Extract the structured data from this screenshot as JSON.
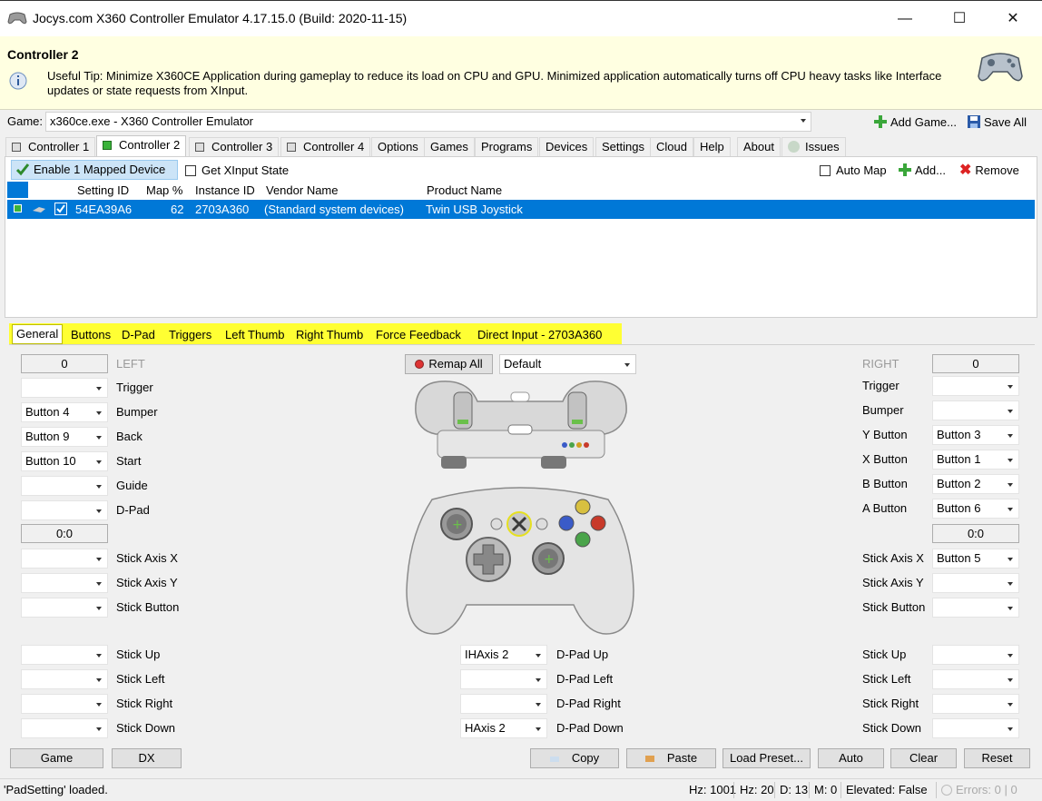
{
  "window": {
    "title": "Jocys.com X360 Controller Emulator 4.17.15.0 (Build: 2020-11-15)",
    "minimize": "—",
    "maximize": "☐",
    "close": "✕"
  },
  "tip": {
    "heading": "Controller 2",
    "text": "Useful Tip: Minimize X360CE Application during gameplay to reduce its load on CPU and GPU. Minimized application automatically turns off CPU heavy tasks like Interface updates or state requests from XInput."
  },
  "game": {
    "label": "Game:",
    "value": "x360ce.exe - X360 Controller Emulator",
    "add_game": "Add Game...",
    "save_all": "Save All"
  },
  "tabs": [
    "Controller 1",
    "Controller 2",
    "Controller 3",
    "Controller 4",
    "Options",
    "Games",
    "Programs",
    "Devices",
    "Settings",
    "Cloud",
    "Help",
    "About",
    "Issues"
  ],
  "device_toolbar": {
    "enable": "Enable 1 Mapped Device",
    "get_xinput": "Get XInput State",
    "auto_map": "Auto Map",
    "add": "Add...",
    "remove": "Remove"
  },
  "device_table": {
    "headers": [
      "Setting ID",
      "Map %",
      "Instance ID",
      "Vendor Name",
      "Product Name"
    ],
    "row": {
      "setting_id": "54EA39A6",
      "map": "62",
      "instance_id": "2703A360",
      "vendor": "(Standard system devices)",
      "product": "Twin USB Joystick"
    }
  },
  "lower_tabs": [
    "General",
    "Buttons",
    "D-Pad",
    "Triggers",
    "Left Thumb",
    "Right Thumb",
    "Force Feedback",
    "Direct Input - 2703A360"
  ],
  "general": {
    "left_value": "0",
    "left_label": "LEFT",
    "right_value": "0",
    "right_label": "RIGHT",
    "remap_all": "Remap All",
    "preset": "Default",
    "left_rows": [
      {
        "value": "",
        "label": "Trigger"
      },
      {
        "value": "Button 4",
        "label": "Bumper"
      },
      {
        "value": "Button 9",
        "label": "Back"
      },
      {
        "value": "Button 10",
        "label": "Start"
      },
      {
        "value": "",
        "label": "Guide"
      },
      {
        "value": "",
        "label": "D-Pad"
      }
    ],
    "right_rows": [
      {
        "value": "",
        "label": "Trigger"
      },
      {
        "value": "",
        "label": "Bumper"
      },
      {
        "value": "Button 3",
        "label": "Y Button"
      },
      {
        "value": "Button 1",
        "label": "X Button"
      },
      {
        "value": "Button 2",
        "label": "B Button"
      },
      {
        "value": "Button 6",
        "label": "A Button"
      }
    ],
    "left_stick_value": "0:0",
    "right_stick_value": "0:0",
    "left_stick_rows": [
      {
        "value": "",
        "label": "Stick Axis X"
      },
      {
        "value": "",
        "label": "Stick Axis Y"
      },
      {
        "value": "",
        "label": "Stick Button"
      }
    ],
    "right_stick_rows": [
      {
        "value": "Button 5",
        "label": "Stick Axis X"
      },
      {
        "value": "",
        "label": "Stick Axis Y"
      },
      {
        "value": "",
        "label": "Stick Button"
      }
    ],
    "left_dir_rows": [
      {
        "value": "",
        "label": "Stick Up"
      },
      {
        "value": "",
        "label": "Stick Left"
      },
      {
        "value": "",
        "label": "Stick Right"
      },
      {
        "value": "",
        "label": "Stick Down"
      }
    ],
    "dpad_rows": [
      {
        "value": "IHAxis 2",
        "label": "D-Pad Up"
      },
      {
        "value": "",
        "label": "D-Pad Left"
      },
      {
        "value": "",
        "label": "D-Pad Right"
      },
      {
        "value": "HAxis 2",
        "label": "D-Pad Down"
      }
    ],
    "right_dir_rows": [
      {
        "value": "",
        "label": "Stick Up"
      },
      {
        "value": "",
        "label": "Stick Left"
      },
      {
        "value": "",
        "label": "Stick Right"
      },
      {
        "value": "",
        "label": "Stick Down"
      }
    ]
  },
  "bottom_buttons": [
    "Game",
    "DX",
    "Copy",
    "Paste",
    "Load Preset...",
    "Auto",
    "Clear",
    "Reset"
  ],
  "status": {
    "message": "'PadSetting' loaded.",
    "hz": "Hz: 1001",
    "hz2": "Hz: 20",
    "d": "D: 13",
    "m": "M: 0",
    "elevated": "Elevated: False",
    "errors": "Errors: 0 | 0"
  },
  "colors": {
    "selection": "#0078d7",
    "tip_bg": "#ffffe1",
    "highlight": "#ffff33"
  }
}
